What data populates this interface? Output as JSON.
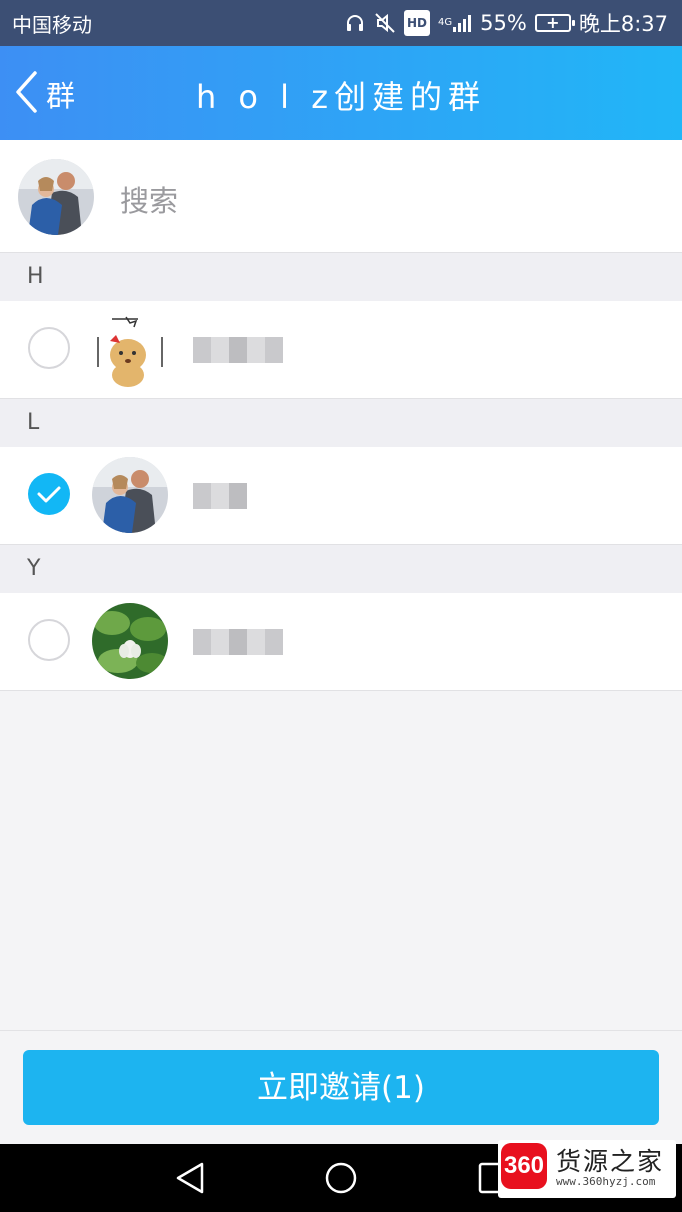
{
  "status_bar": {
    "carrier": "中国移动",
    "network": "4G",
    "battery": "55%",
    "time": "晚上8:37",
    "icons": [
      "headset-icon",
      "mute-icon",
      "hd-icon",
      "signal-icon",
      "battery-icon"
    ]
  },
  "nav": {
    "back_label": "群",
    "title": "h o l z创建的群"
  },
  "search": {
    "placeholder": "搜索"
  },
  "sections": [
    {
      "letter": "H"
    },
    {
      "letter": "L"
    },
    {
      "letter": "Y"
    }
  ],
  "members": [
    {
      "section": "H",
      "checked": false,
      "avatar": "cartoon-dog-avatar",
      "name_obscured": true
    },
    {
      "section": "L",
      "checked": true,
      "avatar": "couple-photo-avatar",
      "name_obscured": true
    },
    {
      "section": "Y",
      "checked": false,
      "avatar": "lotus-flower-avatar",
      "name_obscured": true
    }
  ],
  "invite_button": {
    "label": "立即邀请(1)"
  },
  "watermark": {
    "logo_text": "360",
    "name": "货源之家",
    "url": "www.360hyzj.com"
  },
  "colors": {
    "accent": "#12b7f5",
    "nav_gradient_start": "#3d8ff4",
    "nav_gradient_end": "#21b6f7",
    "status_bar": "#3c4f74"
  }
}
